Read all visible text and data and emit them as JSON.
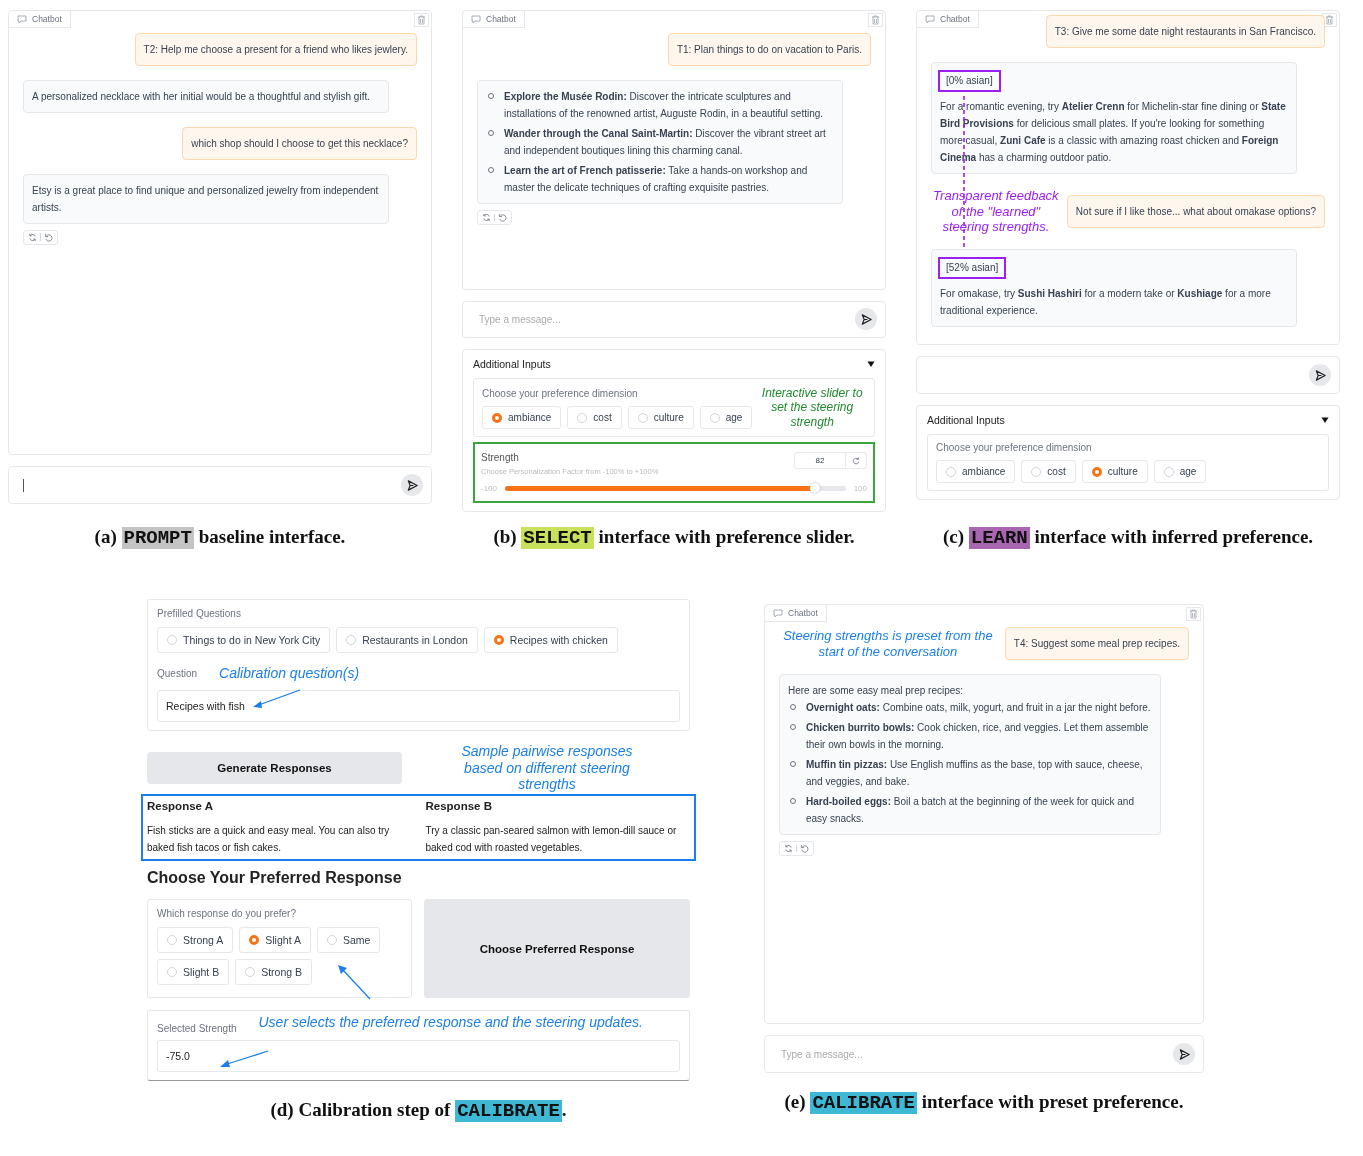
{
  "rows": [
    {
      "panels": [
        {
          "kind": "prompt",
          "chatbot": {
            "label": "Chatbot",
            "actions": true,
            "messages": [
              {
                "kind": "user",
                "text": "T2: Help me choose a present for a friend who likes jewlery."
              },
              {
                "kind": "bot",
                "text": "A personalized necklace with her initial would be a thoughtful and stylish gift."
              },
              {
                "kind": "user",
                "text": "which shop should I choose to get this necklace?"
              },
              {
                "kind": "bot",
                "text": "Etsy is a great place to find unique and personalized jewelry from independent artists."
              }
            ]
          },
          "input": {
            "cursor": true
          },
          "caption": {
            "before": "(a) ",
            "tag": "PROMPT",
            "color": "#c4c4c4",
            "after": " baseline interface."
          }
        },
        {
          "kind": "select",
          "chatbot": {
            "label": "Chatbot",
            "actions": true,
            "messages": [
              {
                "kind": "user",
                "text": "T1: Plan things to do on vacation to Paris."
              },
              {
                "kind": "bot",
                "items": [
                  "**Explore the Musée Rodin:** Discover the intricate sculptures and installations of the renowned artist, Auguste Rodin, in a beautiful setting.",
                  "**Wander through the Canal Saint-Martin:** Discover the vibrant street art and independent boutiques lining this charming canal.",
                  "**Learn the art of French patisserie:** Take a hands-on workshop and master the delicate techniques of crafting exquisite pastries."
                ]
              }
            ]
          },
          "input": {
            "cursor": false,
            "placeholder": "Type a message..."
          },
          "additional_inputs": {
            "title": "Additional Inputs",
            "expanded": true,
            "dimension": {
              "label": "Choose your preference dimension",
              "options": [
                {
                  "label": "ambiance",
                  "selected": true
                },
                {
                  "label": "cost",
                  "selected": false
                },
                {
                  "label": "culture",
                  "selected": false
                },
                {
                  "label": "age",
                  "selected": false
                }
              ],
              "note": {
                "text": "Interactive slider to set the steering strength",
                "color": "#1e8a2e"
              }
            },
            "strength": {
              "label": "Strength",
              "hint": "Choose Personalization Factor from -100% to +100%",
              "value": "82",
              "min": "-100",
              "max": "100",
              "level": 0.91
            }
          },
          "caption": {
            "before": "(b) ",
            "tag": "SELECT",
            "color": "#c8e05a",
            "after": " interface with preference slider."
          }
        },
        {
          "kind": "learn",
          "chatbot": {
            "label": "Chatbot",
            "actions": false,
            "messages": [
              {
                "kind": "user",
                "text": "T3: Give me some date night restaurants in San Francisco."
              },
              {
                "kind": "bot",
                "tag": "[0% asian]",
                "text": "For a romantic evening, try **Atelier Crenn** for Michelin-star fine dining or **State Bird Provisions** for delicious small plates. If you're looking for something more casual, **Zuni Cafe** is a classic with amazing roast chicken and **Foreign Cinema** has a charming outdoor patio."
              },
              {
                "kind": "user",
                "text": "Not sure if I like those... what about omakase options?",
                "note": {
                  "text": "Transparent feedback of the \"learned\" steering strengths.",
                  "color": "#9b1ff0"
                }
              },
              {
                "kind": "bot",
                "tag": "[52% asian]",
                "text": "For omakase, try **Sushi Hashiri** for a modern take or **Kushiage** for a more traditional experience."
              }
            ]
          },
          "input": {
            "cursor": false
          },
          "additional_inputs": {
            "title": "Additional Inputs",
            "expanded": true,
            "dimension": {
              "label": "Choose your preference dimension",
              "options": [
                {
                  "label": "ambiance",
                  "selected": false
                },
                {
                  "label": "cost",
                  "selected": false
                },
                {
                  "label": "culture",
                  "selected": true
                },
                {
                  "label": "age",
                  "selected": false
                }
              ]
            }
          },
          "caption": {
            "before": "(c) ",
            "tag": "LEARN",
            "color": "#a866b0",
            "after": " interface with inferred preference."
          }
        }
      ]
    },
    {
      "panels": [
        {
          "kind": "calibrate",
          "calibration": {
            "prefilled": {
              "label": "Prefilled Questions",
              "options": [
                {
                  "label": "Things to do in New York City",
                  "selected": false
                },
                {
                  "label": "Restaurants in London",
                  "selected": false
                },
                {
                  "label": "Recipes with chicken",
                  "selected": true
                }
              ]
            },
            "question": {
              "label": "Question",
              "value": "Recipes with fish",
              "note": {
                "text": "Calibration question(s)",
                "color": "#1a7fe8"
              }
            },
            "generate": {
              "label": "Generate Responses",
              "note": {
                "text": "Sample pairwise responses based on different steering strengths",
                "color": "#1a7fe8"
              }
            },
            "responses": [
              {
                "title": "Response A",
                "text": "Fish sticks are a quick and easy meal. You can also try baked fish tacos or fish cakes."
              },
              {
                "title": "Response B",
                "text": "Try a classic pan-seared salmon with lemon-dill sauce or baked cod with roasted vegetables."
              }
            ],
            "heading": "Choose Your Preferred Response",
            "preference": {
              "label": "Which response do you prefer?",
              "options": [
                {
                  "label": "Strong A",
                  "selected": false
                },
                {
                  "label": "Slight A",
                  "selected": true
                },
                {
                  "label": "Same",
                  "selected": false
                },
                {
                  "label": "Slight B",
                  "selected": false
                },
                {
                  "label": "Strong B",
                  "selected": false
                }
              ]
            },
            "submit": "Choose Preferred Response",
            "selected_strength": {
              "label": "Selected Strength",
              "value": "-75.0",
              "note": {
                "text": "User selects the preferred response and the steering updates.",
                "color": "#1a7fe8"
              }
            }
          },
          "caption": {
            "before": "(d) Calibration step of ",
            "tag": "CALIBRATE",
            "color": "#3fb8d6",
            "after": "."
          }
        },
        {
          "kind": "preset",
          "chatbot": {
            "label": "Chatbot",
            "actions": true,
            "messages": [
              {
                "kind": "user",
                "text": "T4: Suggest some meal prep recipes.",
                "note": {
                  "text": "Steering strengths is preset from the start of the conversation",
                  "color": "#1a7fe8"
                }
              },
              {
                "kind": "bot",
                "intro": "Here are some easy meal prep recipes:",
                "items": [
                  "**Overnight oats:** Combine oats, milk, yogurt, and fruit in a jar the night before.",
                  "**Chicken burrito bowls:** Cook chicken, rice, and veggies. Let them assemble their own bowls in the morning.",
                  "**Muffin tin pizzas:** Use English muffins as the base, top with sauce, cheese, and veggies, and bake.",
                  "**Hard-boiled eggs:** Boil a batch at the beginning of the week for quick and easy snacks."
                ]
              }
            ]
          },
          "input": {
            "cursor": false,
            "placeholder": "Type a message..."
          },
          "caption": {
            "before": "(e) ",
            "tag": "CALIBRATE",
            "color": "#3fb8d6",
            "after": " interface with preset preference."
          }
        }
      ]
    }
  ]
}
